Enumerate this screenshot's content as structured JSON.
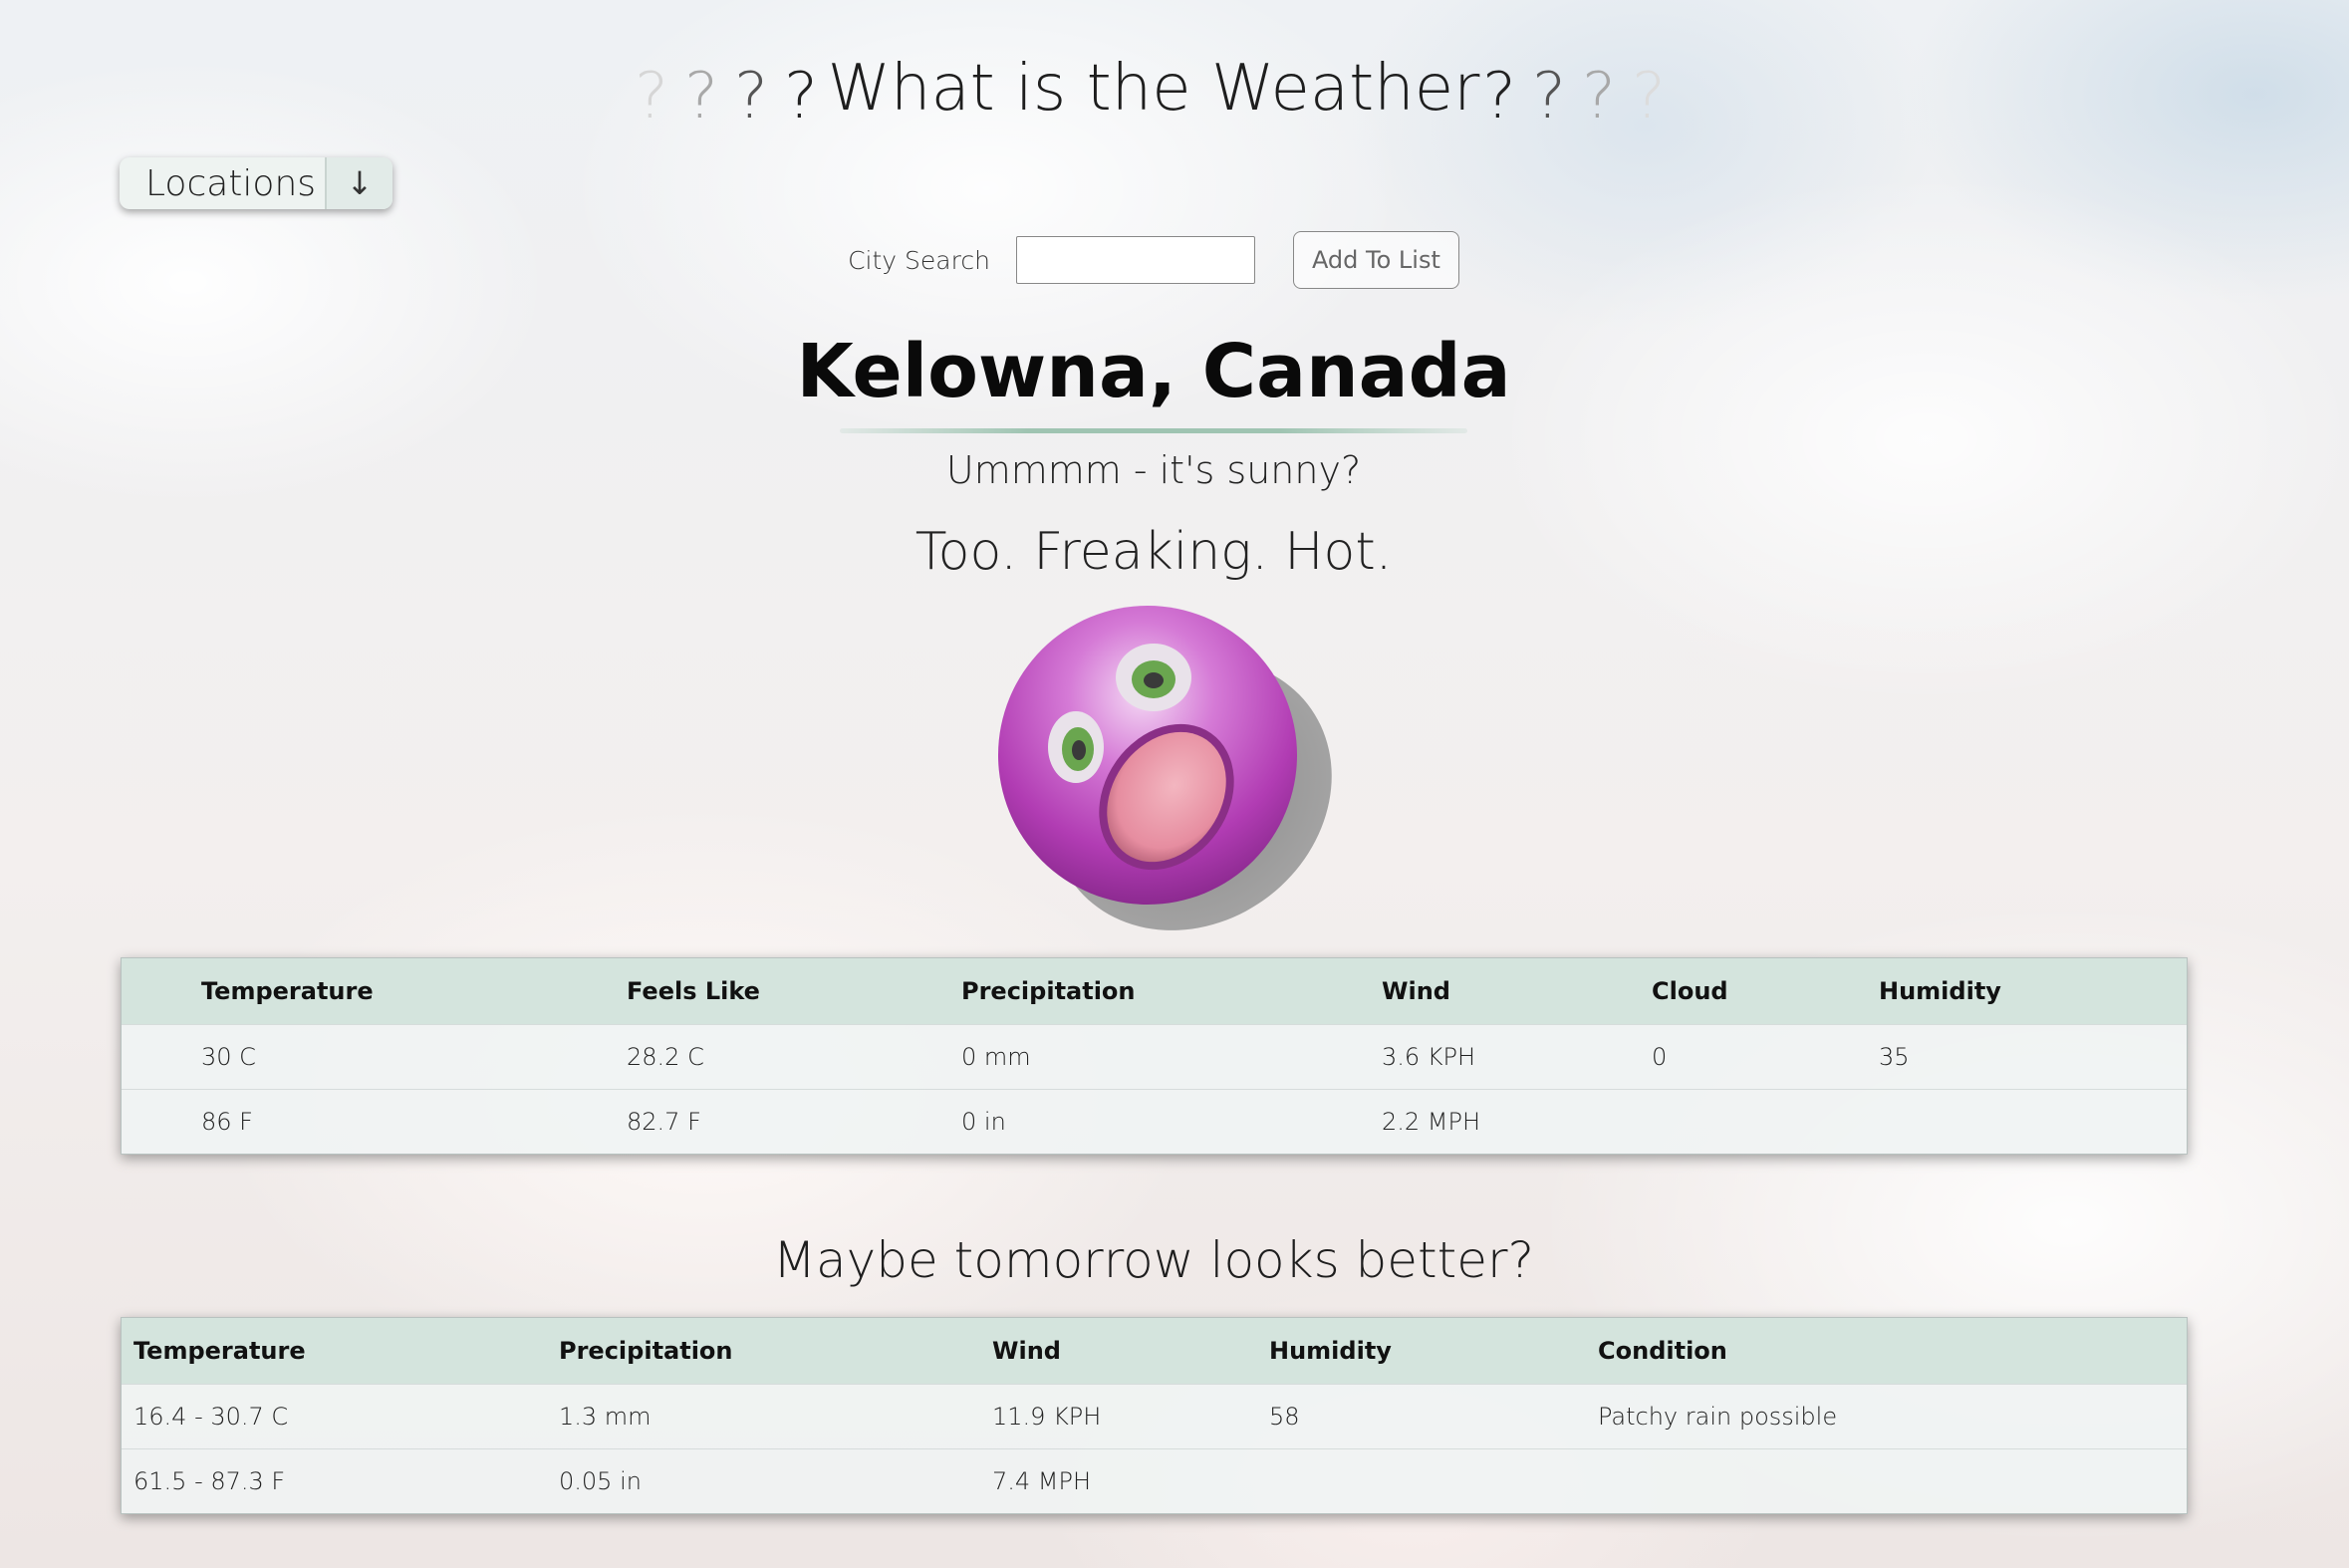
{
  "header": {
    "title": "What is the Weather",
    "left_marks": [
      "?",
      "?",
      "?",
      "?"
    ],
    "right_marks": [
      "?",
      "?",
      "?",
      "?"
    ]
  },
  "locations_dropdown": {
    "label": "Locations",
    "arrow": "↓"
  },
  "search": {
    "label": "City Search",
    "value": "",
    "placeholder": "",
    "add_button_label": "Add To List"
  },
  "current": {
    "city": "Kelowna, Canada",
    "condition_text": "Ummmm - it's sunny?",
    "verdict": "Too. Freaking. Hot.",
    "face_icon": "surprised-purple-face-icon",
    "headers": [
      "Temperature",
      "Feels Like",
      "Precipitation",
      "Wind",
      "Cloud",
      "Humidity"
    ],
    "rows": [
      [
        "30 C",
        "28.2 C",
        "0 mm",
        "3.6 KPH",
        "0",
        "35"
      ],
      [
        "86 F",
        "82.7 F",
        "0 in",
        "2.2 MPH",
        "",
        ""
      ]
    ]
  },
  "forecast": {
    "heading": "Maybe tomorrow looks better?",
    "headers": [
      "Temperature",
      "Precipitation",
      "Wind",
      "Humidity",
      "Condition"
    ],
    "rows": [
      [
        "16.4 - 30.7 C",
        "1.3 mm",
        "11.9 KPH",
        "58",
        "Patchy rain possible"
      ],
      [
        "61.5 - 87.3 F",
        "0.05 in",
        "7.4 MPH",
        "",
        ""
      ]
    ]
  },
  "colors": {
    "table_header_bg": "#d4e4dd",
    "accent_underline": "#9fc4b2",
    "face_purple": "#b23fb4"
  }
}
